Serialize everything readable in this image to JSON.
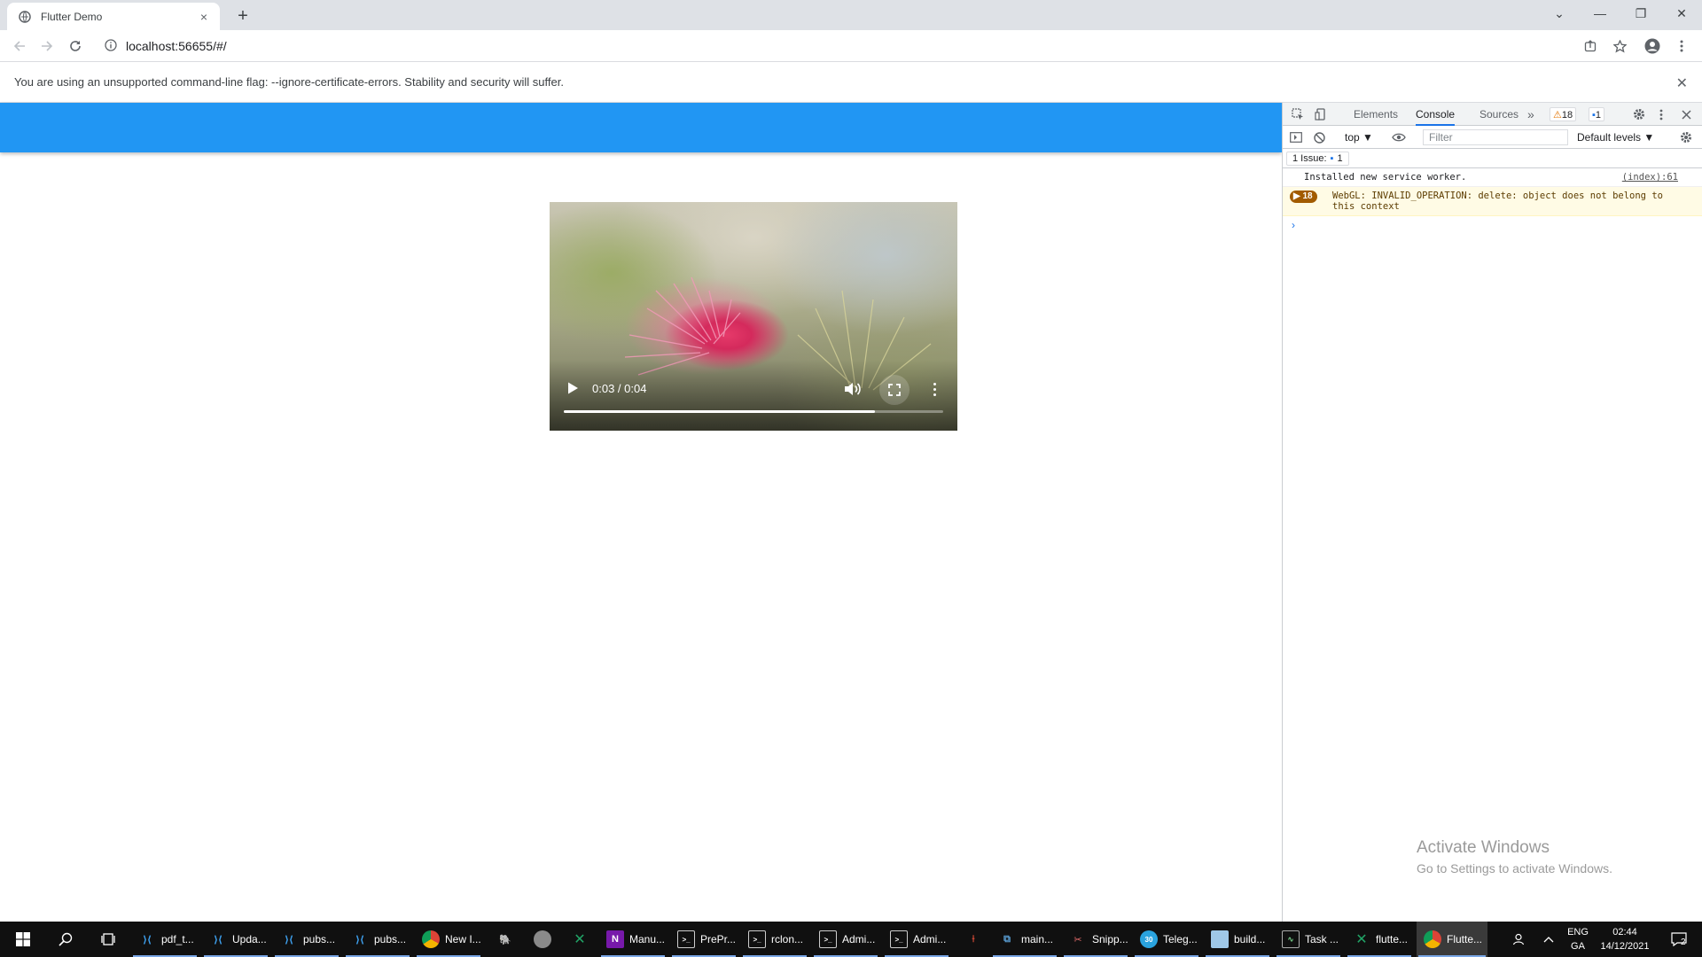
{
  "browser": {
    "tab_title": "Flutter Demo",
    "tab_close": "×",
    "new_tab": "+",
    "url": "localhost:56655/#/",
    "window_controls": {
      "tab_search": "⌄",
      "minimize": "—",
      "restore": "❐",
      "close": "✕"
    }
  },
  "infobar": {
    "message": "You are using an unsupported command-line flag: --ignore-certificate-errors. Stability and security will suffer.",
    "close": "✕"
  },
  "app": {
    "appbar_color": "#2196f3"
  },
  "video": {
    "time": "0:03 / 0:04",
    "progress_fraction": 0.82
  },
  "devtools": {
    "tabs": [
      "Elements",
      "Console",
      "Sources"
    ],
    "active_tab": "Console",
    "more_tabs": "»",
    "warning_count": "18",
    "message_count": "1",
    "context": "top ▼",
    "filter_placeholder": "Filter",
    "levels": "Default levels ▼",
    "issues_label": "1 Issue:",
    "issues_count": "1",
    "messages": [
      {
        "text": "Installed new service worker.",
        "source": "(index):61"
      },
      {
        "count": "18",
        "text": "WebGL: INVALID_OPERATION: delete: object does not belong to this context"
      }
    ],
    "prompt": "›"
  },
  "watermark": {
    "line1": "Activate Windows",
    "line2": "Go to Settings to activate Windows."
  },
  "taskbar": {
    "items": [
      {
        "label": "pdf_t...",
        "icon": "vscode-icon"
      },
      {
        "label": "Upda...",
        "icon": "vscode-icon"
      },
      {
        "label": "pubs...",
        "icon": "vscode-icon"
      },
      {
        "label": "pubs...",
        "icon": "vscode-icon"
      },
      {
        "label": "New I...",
        "icon": "chrome-icon"
      },
      {
        "label": "Manu...",
        "icon": "onenote-icon"
      },
      {
        "label": "PrePr...",
        "icon": "terminal-icon"
      },
      {
        "label": "rclon...",
        "icon": "terminal-icon"
      },
      {
        "label": "Admi...",
        "icon": "terminal-icon"
      },
      {
        "label": "Admi...",
        "icon": "terminal-icon"
      },
      {
        "label": "main...",
        "icon": "python-icon"
      },
      {
        "label": "Snipp...",
        "icon": "snipping-icon"
      },
      {
        "label": "Teleg...",
        "icon": "telegram-icon"
      },
      {
        "label": "build...",
        "icon": "notepad-icon"
      },
      {
        "label": "Task ...",
        "icon": "task-manager-icon"
      },
      {
        "label": "flutte...",
        "icon": "excel-icon"
      },
      {
        "label": "Flutte...",
        "icon": "chrome-icon"
      }
    ],
    "telegram_badge": "30",
    "language": "ENG",
    "layout": "GA",
    "time": "02:44",
    "date": "14/12/2021",
    "notifications": "2"
  }
}
